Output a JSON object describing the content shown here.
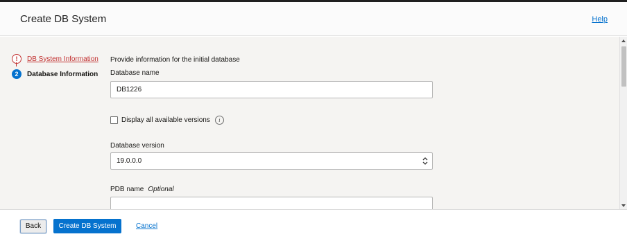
{
  "header": {
    "title": "Create DB System",
    "help_link": "Help"
  },
  "steps": [
    {
      "number": "!",
      "label": "DB System Information",
      "status": "error"
    },
    {
      "number": "2",
      "label": "Database Information",
      "status": "current"
    }
  ],
  "form": {
    "intro": "Provide information for the initial database",
    "db_name": {
      "label": "Database name",
      "value": "DB1226"
    },
    "display_versions": {
      "label": "Display all available versions",
      "checked": false,
      "info_icon": "i"
    },
    "db_version": {
      "label": "Database version",
      "value": "19.0.0.0"
    },
    "pdb_name": {
      "label": "PDB name",
      "optional": "Optional",
      "value": ""
    }
  },
  "footer": {
    "back_label": "Back",
    "create_label": "Create DB System",
    "cancel_label": "Cancel"
  },
  "colors": {
    "accent": "#0572ce",
    "error": "#c23030",
    "content_bg": "#f5f4f2"
  }
}
